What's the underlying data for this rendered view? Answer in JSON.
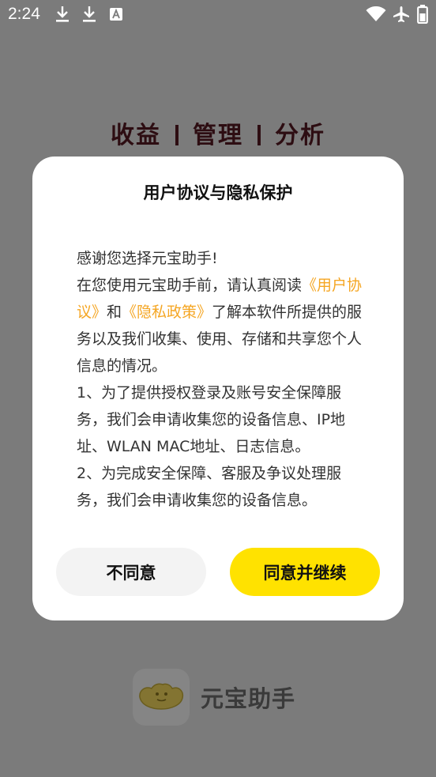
{
  "status_bar": {
    "time": "2:24",
    "icons": [
      "download-icon",
      "download-icon",
      "font-icon",
      "wifi-icon",
      "airplane-icon",
      "battery-icon"
    ]
  },
  "background": {
    "headline": [
      "收益",
      "管理",
      "分析"
    ],
    "brand_name": "元宝助手"
  },
  "dialog": {
    "title": "用户协议与隐私保护",
    "greeting": "感谢您选择元宝助手!",
    "intro_before": "在您使用元宝助手前，请认真阅读",
    "user_agreement_link": "《用户协议》",
    "and": "和",
    "privacy_policy_link": "《隐私政策》",
    "intro_after": "了解本软件所提供的服务以及我们收集、使用、存储和共享您个人信息的情况。",
    "item1": "1、为了提供授权登录及账号安全保障服务，我们会申请收集您的设备信息、IP地址、WLAN MAC地址、日志信息。",
    "item2": "2、为完成安全保障、客服及争议处理服务，我们会申请收集您的设备信息。",
    "disagree_label": "不同意",
    "agree_label": "同意并继续"
  },
  "colors": {
    "accent_yellow": "#ffe200",
    "link_orange": "#f5a623",
    "overlay_gray": "#7b7b7b"
  }
}
